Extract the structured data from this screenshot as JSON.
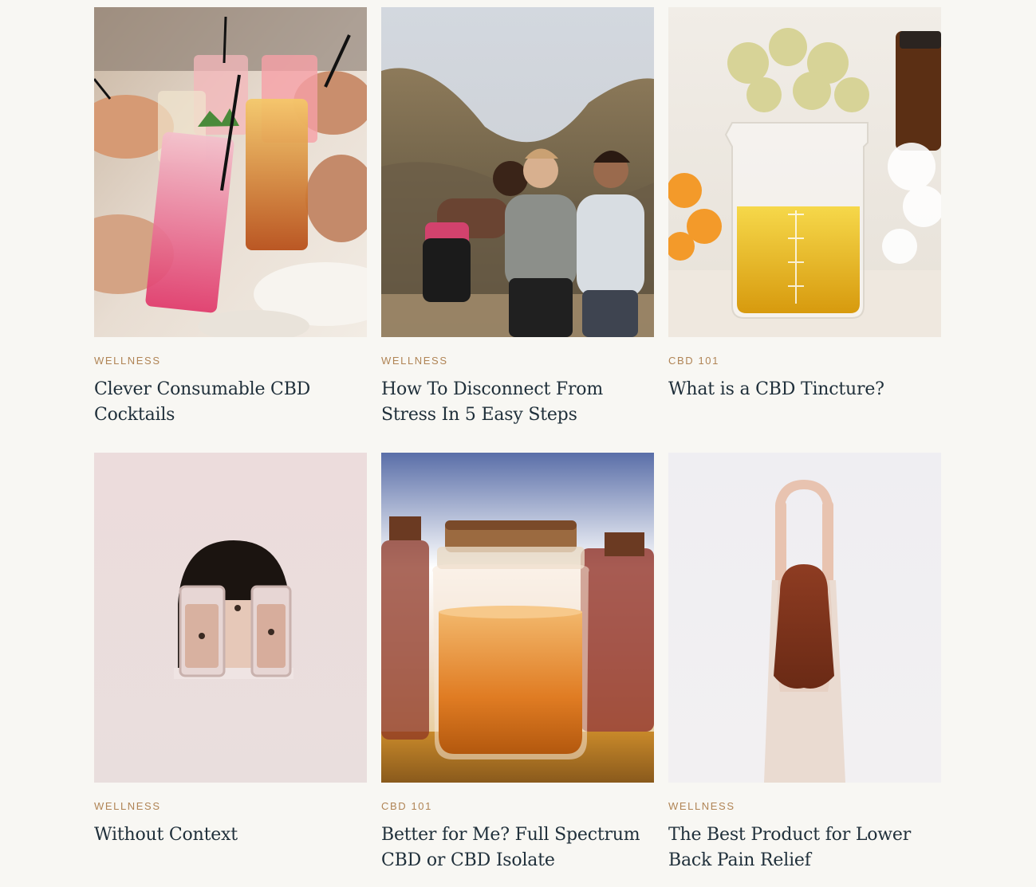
{
  "articles": [
    {
      "category": "WELLNESS",
      "title": "Clever Consumable CBD Cocktails",
      "image": "cocktails-toast-photo"
    },
    {
      "category": "WELLNESS",
      "title": "How To Disconnect From Stress In 5 Easy Steps",
      "image": "friends-hiking-photo"
    },
    {
      "category": "CBD 101",
      "title": "What is a CBD Tincture?",
      "image": "beaker-oil-flowers-photo"
    },
    {
      "category": "WELLNESS",
      "title": "Without Context",
      "image": "woman-behind-glasses-photo"
    },
    {
      "category": "CBD 101",
      "title": "Better for Me? Full Spectrum CBD or CBD Isolate",
      "image": "cork-jar-honey-photo"
    },
    {
      "category": "WELLNESS",
      "title": "The Best Product for Lower Back Pain Relief",
      "image": "woman-stretching-photo"
    }
  ],
  "colors": {
    "background": "#f8f7f3",
    "category": "#b08455",
    "title": "#1f2f3a"
  }
}
